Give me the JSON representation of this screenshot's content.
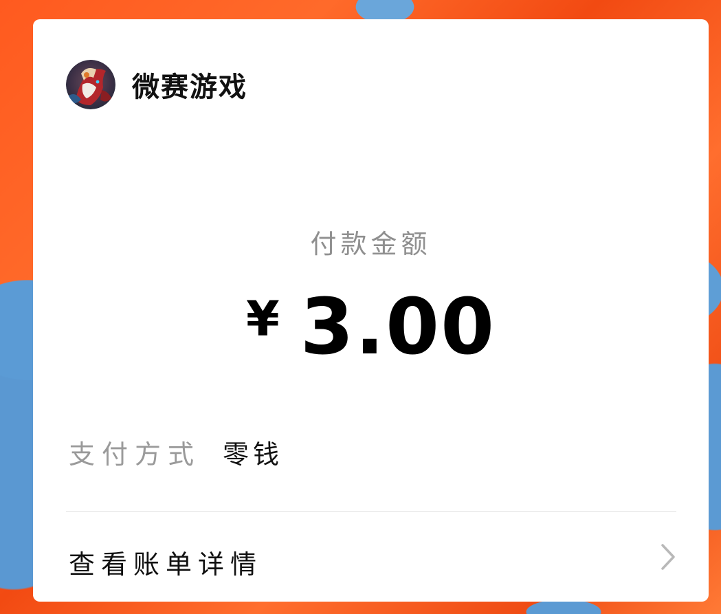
{
  "merchant": {
    "name": "微赛游戏"
  },
  "payment": {
    "amount_label": "付款金额",
    "currency_symbol": "¥",
    "amount": "3.00",
    "method_label": "支付方式",
    "method_value": "零钱"
  },
  "details": {
    "label": "查看账单详情"
  },
  "colors": {
    "card_background": "#ffffff",
    "secondary_text": "#8f8f8f",
    "primary_text": "#111111",
    "divider": "#e2e2e2"
  },
  "icons": {
    "avatar": "merchant-avatar",
    "detail_arrow": "chevron-right-icon"
  }
}
